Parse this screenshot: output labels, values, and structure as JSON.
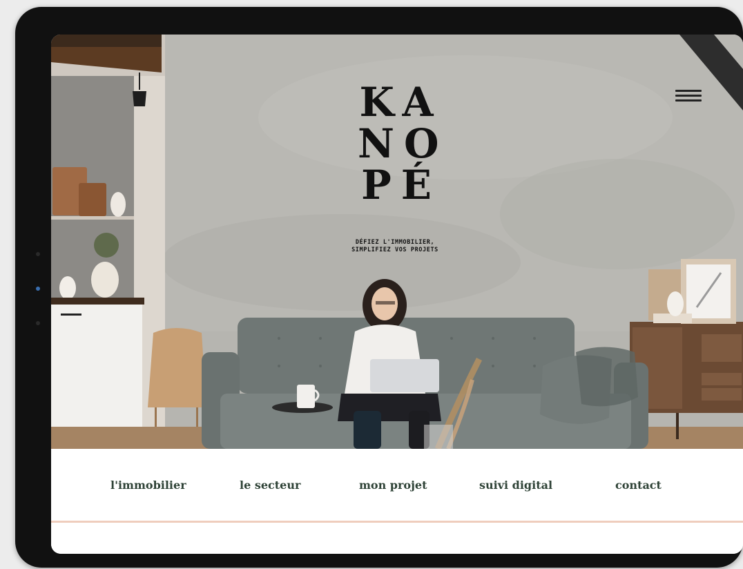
{
  "brand": {
    "logo_lines": [
      "KA",
      "NO",
      "PÉ"
    ],
    "tagline_line1": "DÉFIEZ L'IMMOBILIER,",
    "tagline_line2": "SIMPLIFIEZ VOS PROJETS"
  },
  "nav": {
    "items": [
      {
        "label": "l'immobilier"
      },
      {
        "label": "le secteur"
      },
      {
        "label": "mon projet"
      },
      {
        "label": "suivi digital"
      },
      {
        "label": "contact"
      }
    ]
  },
  "icons": {
    "menu": "hamburger-menu-icon"
  },
  "colors": {
    "nav_text": "#2e4236",
    "accent_rule": "#efcdbd",
    "tablet_bezel": "#111111"
  }
}
